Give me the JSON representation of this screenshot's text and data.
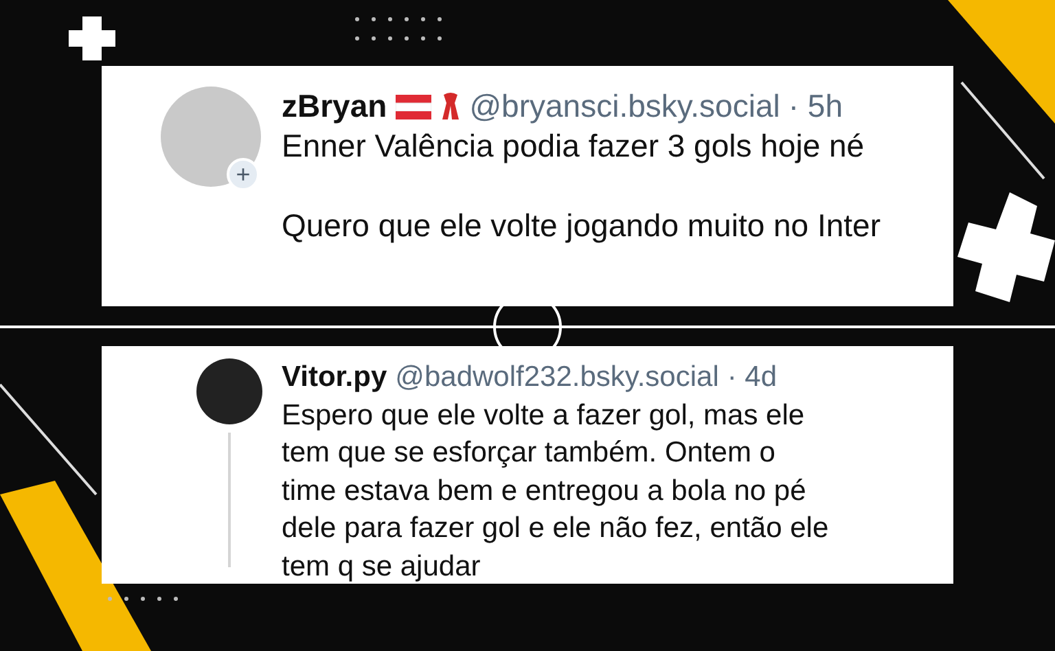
{
  "posts": [
    {
      "kind": "main",
      "name": "zBryan",
      "handle": "@bryansci.bsky.social",
      "time": "· 5h",
      "follow_button": "+",
      "body": [
        "Enner Valência podia fazer 3 gols hoje né",
        "Quero que ele volte jogando muito no Inter"
      ]
    },
    {
      "kind": "reply",
      "name": "Vitor.py",
      "handle": "@badwolf232.bsky.social",
      "time": "· 4d",
      "body": [
        "Espero que ele volte a fazer gol, mas ele tem que se esforçar também. Ontem o time estava bem e entregou a bola no pé dele para fazer gol e ele não fez, então ele tem q se ajudar"
      ]
    }
  ]
}
